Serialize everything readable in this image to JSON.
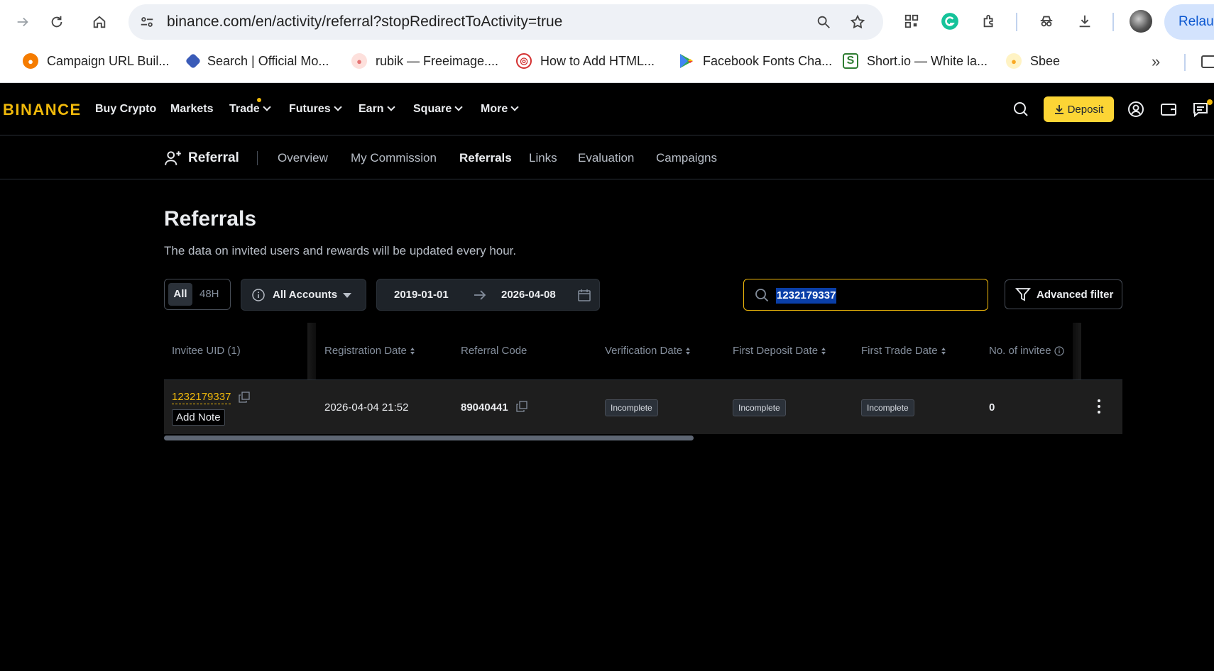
{
  "browser": {
    "url": "binance.com/en/activity/referral?stopRedirectToActivity=true",
    "relaunch_label": "Relaunch",
    "bookmarks": [
      {
        "label": "Campaign URL Buil...",
        "icon": "campaign-url-builder-favicon",
        "color": "#f57c00"
      },
      {
        "label": "Search | Official Mo...",
        "icon": "search-favicon",
        "color": "#3a5bb8"
      },
      {
        "label": "rubik — Freeimage....",
        "icon": "freeimage-favicon",
        "color": "#e57373"
      },
      {
        "label": "How to Add HTML...",
        "icon": "html-favicon",
        "color": "#d32f2f"
      },
      {
        "label": "Facebook Fonts Cha...",
        "icon": "google-play-favicon",
        "color": "#34a853"
      },
      {
        "label": "Short.io — White la...",
        "icon": "shortio-favicon",
        "color": "#2e7d32"
      },
      {
        "label": "Sbee",
        "icon": "sbee-favicon",
        "color": "#f9a825"
      }
    ]
  },
  "header": {
    "logo": "BINANCE",
    "nav": [
      "Buy Crypto",
      "Markets",
      "Trade",
      "Futures",
      "Earn",
      "Square",
      "More"
    ],
    "deposit_label": "Deposit",
    "accent": "#f0b90b"
  },
  "subnav": {
    "title": "Referral",
    "tabs": [
      "Overview",
      "My Commission",
      "Referrals",
      "Links",
      "Evaluation",
      "Campaigns"
    ],
    "active": "Referrals"
  },
  "main": {
    "title": "Referrals",
    "subtitle": "The data on invited users and rewards will be updated every hour.",
    "filters": {
      "period_all": "All",
      "period_48h": "48H",
      "account": "All Accounts",
      "date_from": "2019-01-01",
      "date_to": "2026-04-08",
      "search_value": "1232179337",
      "advanced_filter": "Advanced filter"
    }
  },
  "table": {
    "columns": [
      "Invitee UID (1)",
      "Registration Date",
      "Referral Code",
      "Verification Date",
      "First Deposit Date",
      "First Trade Date",
      "No. of invitee"
    ],
    "rows": [
      {
        "uid": "1232179337",
        "add_note": "Add Note",
        "registration_date": "2026-04-04 21:52",
        "referral_code": "89040441",
        "verification": "Incomplete",
        "first_deposit": "Incomplete",
        "first_trade": "Incomplete",
        "invitees": "0"
      }
    ]
  }
}
